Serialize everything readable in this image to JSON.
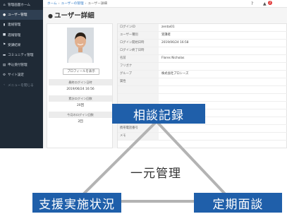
{
  "sidebar": {
    "items": [
      {
        "icon": "⌂",
        "icon_name": "home-icon",
        "label": "管理画面ホーム"
      },
      {
        "icon": "●",
        "icon_name": "user-icon",
        "label": "ユーザー管理"
      },
      {
        "icon": "▮",
        "icon_name": "contact-icon",
        "label": "連絡管理"
      },
      {
        "icon": "■",
        "icon_name": "report-icon",
        "label": "週報管理"
      },
      {
        "icon": "⚑",
        "icon_name": "flag-icon",
        "label": "受講結果"
      },
      {
        "icon": "▬",
        "icon_name": "chat-icon",
        "label": "コミュニティ管理"
      },
      {
        "icon": "▤",
        "icon_name": "document-icon",
        "label": "申込受付管理"
      },
      {
        "icon": "⚙",
        "icon_name": "gear-icon",
        "label": "サイト設定"
      },
      {
        "icon": "‹",
        "icon_name": "chevron-left-icon",
        "label": "メニューを閉じる"
      }
    ]
  },
  "breadcrumb": {
    "home": "ホーム",
    "section": "ユーザーの管理",
    "current": "ユーザー詳細"
  },
  "topbar": {
    "help_icon": "?",
    "bell_icon": "🔔",
    "notification_count": "2"
  },
  "page": {
    "title": "ユーザー詳細"
  },
  "profile": {
    "show_profile_label": "プロフィールを表示",
    "stats": [
      {
        "label": "最終ログイン日時",
        "value": "2019/06/24 16:56"
      },
      {
        "label": "累計ログイン回数",
        "value": "20回"
      },
      {
        "label": "今月のログイン回数",
        "value": "2回"
      }
    ]
  },
  "details": {
    "rows": [
      {
        "label": "ログインID",
        "value": "zentai01"
      },
      {
        "label": "ユーザー種別",
        "value": "受講者"
      },
      {
        "label": "ログイン開始日時",
        "value": "2019/06/24 16:58"
      },
      {
        "label": "ログイン終了日時",
        "value": ""
      },
      {
        "label": "名前",
        "value": "Flores Nicholas"
      },
      {
        "label": "フリガナ",
        "value": ""
      },
      {
        "label": "グループ",
        "value": "株式会社プロシーズ"
      },
      {
        "label": "属性",
        "value": ""
      },
      {
        "label": "",
        "value": ""
      },
      {
        "label": "",
        "value": ""
      },
      {
        "label": "",
        "value": ""
      },
      {
        "label": "",
        "value": ""
      },
      {
        "label": "",
        "value": ""
      },
      {
        "label": "携帯電話番号",
        "value": ""
      },
      {
        "label": "メモ",
        "value": ""
      }
    ]
  },
  "diagram": {
    "top": "相談記録",
    "left": "支援実施状況",
    "right": "定期面談",
    "center": "一元管理",
    "box_color": "#1f5faa",
    "line_color": "#b3b3b3"
  }
}
